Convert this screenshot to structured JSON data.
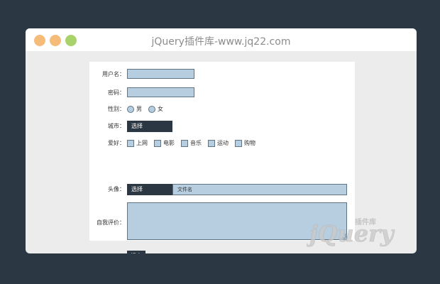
{
  "window": {
    "title": "jQuery插件库-www.jq22.com",
    "dots": [
      "#f5bb79",
      "#f5bb79",
      "#a9d26a"
    ]
  },
  "form": {
    "username_label": "用户名：",
    "password_label": "密码：",
    "gender_label": "性别：",
    "gender_options": [
      "男",
      "女"
    ],
    "city_label": "城市：",
    "city_select": "选择",
    "hobby_label": "爱好：",
    "hobby_options": [
      "上网",
      "电影",
      "音乐",
      "运动",
      "购物"
    ],
    "avatar_label": "头像：",
    "avatar_button": "选择",
    "avatar_filename": "文件名",
    "bio_label": "自我评价：",
    "submit": "提交"
  },
  "watermark": {
    "text": "jQuery",
    "subtext": "插件库"
  },
  "colors": {
    "background": "#2b3742",
    "field": "#b7cde0",
    "field_border": "#5e7485",
    "dark_button": "#2b3742"
  }
}
